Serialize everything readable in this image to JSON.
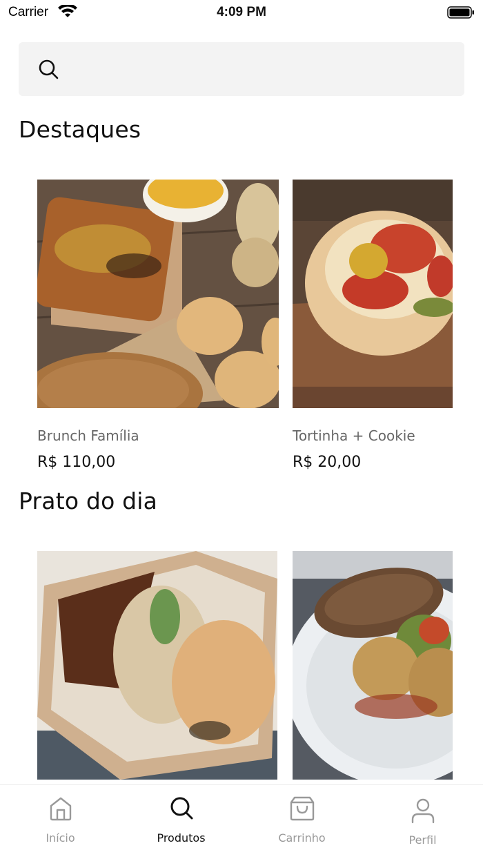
{
  "status_bar": {
    "carrier": "Carrier",
    "time": "4:09 PM"
  },
  "search": {
    "placeholder": "",
    "value": ""
  },
  "sections": [
    {
      "title": "Destaques",
      "items": [
        {
          "name": "Brunch Família",
          "price": "R$ 110,00",
          "image": "bread-and-cookies-photo"
        },
        {
          "name": "Tortinha + Cookie",
          "price": "R$ 20,00",
          "image": "tomato-tart-photo"
        }
      ]
    },
    {
      "title": "Prato do dia",
      "items": [
        {
          "name": "",
          "price": "",
          "image": "rice-box-photo"
        },
        {
          "name": "",
          "price": "",
          "image": "falafel-plate-photo"
        }
      ]
    }
  ],
  "tab_bar": {
    "tabs": [
      {
        "label": "Início",
        "icon": "home-icon",
        "active": false
      },
      {
        "label": "Produtos",
        "icon": "search-icon",
        "active": true
      },
      {
        "label": "Carrinho",
        "icon": "shopping-bag-icon",
        "active": false
      },
      {
        "label": "Perfil",
        "icon": "user-icon",
        "active": false
      }
    ]
  },
  "colors": {
    "text_primary": "#111111",
    "text_secondary": "#666666",
    "tab_inactive": "#999999",
    "search_background": "#f3f3f3"
  }
}
